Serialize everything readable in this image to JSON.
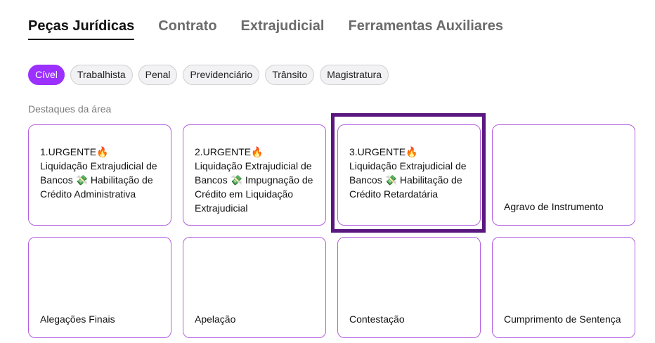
{
  "tabs": [
    {
      "label": "Peças Jurídicas",
      "active": true
    },
    {
      "label": "Contrato",
      "active": false
    },
    {
      "label": "Extrajudicial",
      "active": false
    },
    {
      "label": "Ferramentas Auxiliares",
      "active": false
    }
  ],
  "chips": [
    {
      "label": "Cível",
      "active": true
    },
    {
      "label": "Trabalhista",
      "active": false
    },
    {
      "label": "Penal",
      "active": false
    },
    {
      "label": "Previdenciário",
      "active": false
    },
    {
      "label": "Trânsito",
      "active": false
    },
    {
      "label": "Magistratura",
      "active": false
    }
  ],
  "section": {
    "label": "Destaques da área"
  },
  "cards": [
    {
      "line1": "1.URGENTE🔥",
      "body": "Liquidação Extrajudicial de Bancos 💸 Habilitação de Crédito Administrativa"
    },
    {
      "line1": "2.URGENTE🔥",
      "body": "Liquidação Extrajudicial de Bancos 💸 Impugnação de Crédito em Liquidação Extrajudicial"
    },
    {
      "line1": "3.URGENTE🔥",
      "body": "Liquidação Extrajudicial de Bancos 💸 Habilitação de Crédito Retardatária"
    },
    {
      "line1": "",
      "body": "Agravo de Instrumento"
    },
    {
      "line1": "",
      "body": "Alegações Finais"
    },
    {
      "line1": "",
      "body": "Apelação"
    },
    {
      "line1": "",
      "body": "Contestação"
    },
    {
      "line1": "",
      "body": "Cumprimento de Sentença"
    }
  ],
  "colors": {
    "accent": "#9b30ff",
    "card_border": "#b45fe0",
    "highlight": "#5a1780"
  }
}
